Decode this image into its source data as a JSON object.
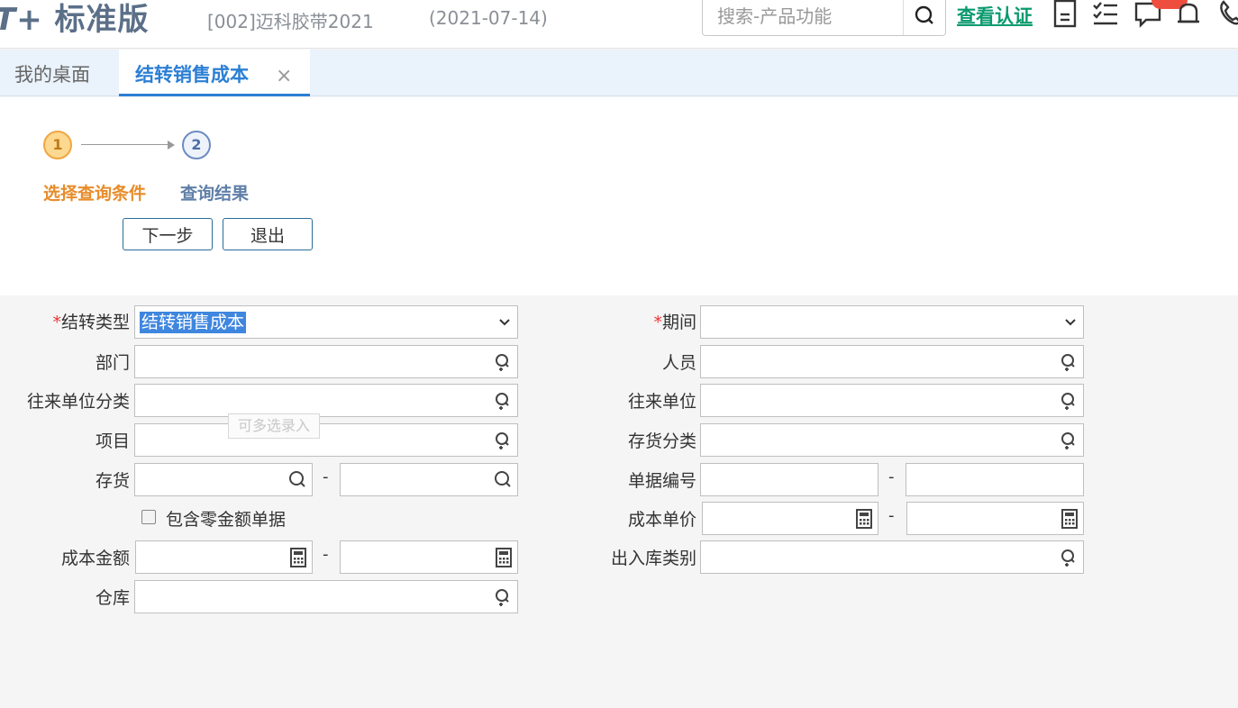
{
  "header": {
    "logo_mark": "T+",
    "logo_text": "标准版",
    "account": "[002]迈科胶带2021",
    "date": "(2021-07-14)",
    "search_placeholder": "搜索-产品功能",
    "cert_link": "查看认证"
  },
  "tabs": {
    "home": "我的桌面",
    "active": "结转销售成本",
    "close": "×"
  },
  "steps": [
    {
      "num": "1",
      "label": "选择查询条件"
    },
    {
      "num": "2",
      "label": "查询结果"
    }
  ],
  "buttons": {
    "next": "下一步",
    "exit": "退出"
  },
  "form": {
    "required_mark": "*",
    "carry_type_label": "结转类型",
    "carry_type_value": "结转销售成本",
    "period_label": "期间",
    "department_label": "部门",
    "person_label": "人员",
    "partner_category_label": "往来单位分类",
    "partner_label": "往来单位",
    "project_label": "项目",
    "multi_hint": "可多选录入",
    "inventory_category_label": "存货分类",
    "inventory_label": "存货",
    "range_dash": "-",
    "doc_number_label": "单据编号",
    "zero_amount_checkbox": "包含零金额单据",
    "unit_cost_label": "成本单价",
    "cost_amount_label": "成本金额",
    "io_type_label": "出入库类别",
    "warehouse_label": "仓库"
  }
}
